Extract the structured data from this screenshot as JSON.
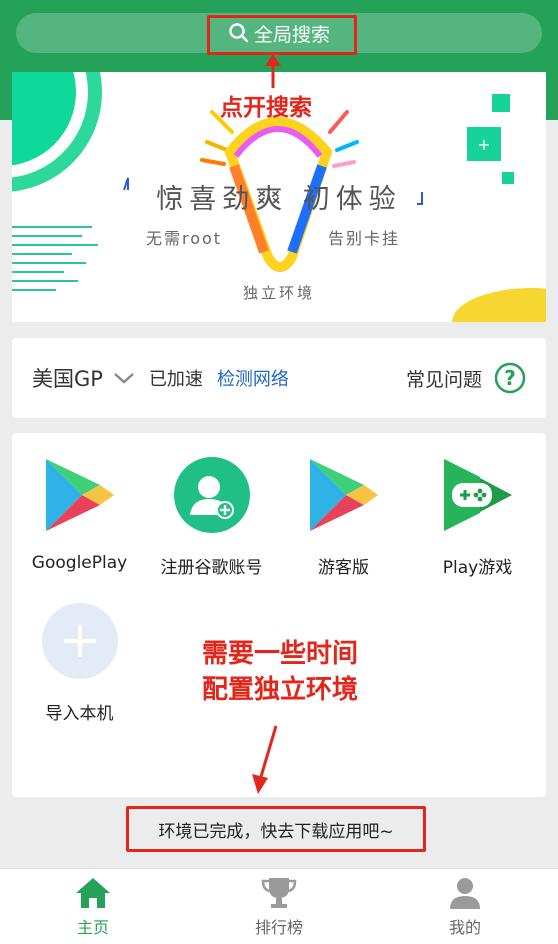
{
  "search": {
    "label": "全局搜索"
  },
  "annotations": {
    "open_search": "点开搜索",
    "needs_time_line1": "需要一些时间",
    "needs_time_line2": "配置独立环境"
  },
  "banner": {
    "title": "惊喜劲爽  初体验",
    "left_sub": "无需root",
    "right_sub": "告别卡挂",
    "bottom": "独立环境"
  },
  "region": {
    "name": "美国GP",
    "status": "已加速",
    "check_network": "检测网络",
    "faq": "常见问题"
  },
  "apps": [
    {
      "label": "GooglePlay",
      "icon": "google-play-icon"
    },
    {
      "label": "注册谷歌账号",
      "icon": "register-google-account-icon"
    },
    {
      "label": "游客版",
      "icon": "google-play-guest-icon"
    },
    {
      "label": "Play游戏",
      "icon": "play-games-icon"
    },
    {
      "label": "导入本机",
      "icon": "add-plus-icon"
    }
  ],
  "toast": {
    "text": "环境已完成，快去下载应用吧~"
  },
  "nav": [
    {
      "label": "主页",
      "icon": "home-icon",
      "active": true
    },
    {
      "label": "排行榜",
      "icon": "trophy-icon",
      "active": false
    },
    {
      "label": "我的",
      "icon": "profile-icon",
      "active": false
    }
  ],
  "colors": {
    "brand_green": "#24a25a",
    "annotation_red": "#e3261b",
    "link_blue": "#1f66c7"
  }
}
